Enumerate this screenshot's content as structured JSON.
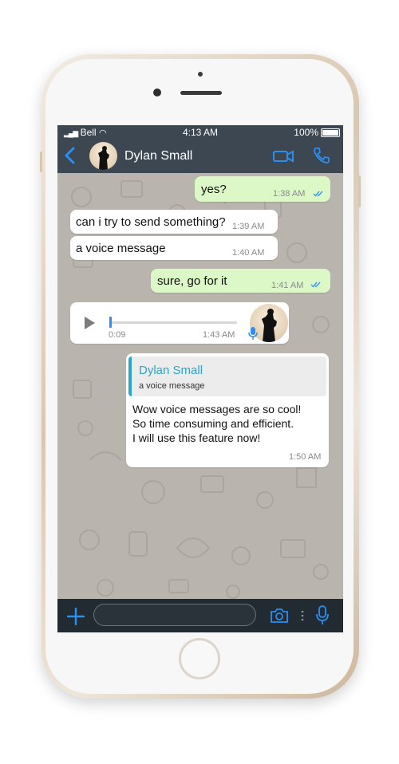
{
  "status_bar": {
    "carrier": "Bell",
    "time": "4:13 AM",
    "battery": "100%"
  },
  "header": {
    "contact_name": "Dylan Small"
  },
  "messages": [
    {
      "text": "yes?",
      "time": "1:38 AM"
    },
    {
      "text": "can i try to send something?",
      "time": "1:39 AM"
    },
    {
      "text": "a voice message",
      "time": "1:40 AM"
    },
    {
      "text": "sure, go for it",
      "time": "1:41 AM"
    }
  ],
  "voice_message": {
    "duration": "0:09",
    "time": "1:43 AM",
    "progress": 0.01
  },
  "reply_message": {
    "quoted_name": "Dylan Small",
    "quoted_text": "a voice message",
    "lines": [
      "Wow voice messages are so cool!",
      "So time consuming and efficient.",
      "I will use this feature now!"
    ],
    "time": "1:50 AM"
  },
  "composer": {
    "placeholder": ""
  },
  "colors": {
    "accent": "#2b8ff0",
    "header_bg": "#3c4752",
    "outgoing_bubble": "#dcf8c6",
    "reply_name": "#2aa6c9"
  },
  "icons": [
    "back-chevron-icon",
    "video-call-icon",
    "phone-call-icon",
    "play-icon",
    "microphone-icon",
    "plus-icon",
    "camera-icon",
    "more-dots-icon",
    "read-ticks-icon"
  ]
}
